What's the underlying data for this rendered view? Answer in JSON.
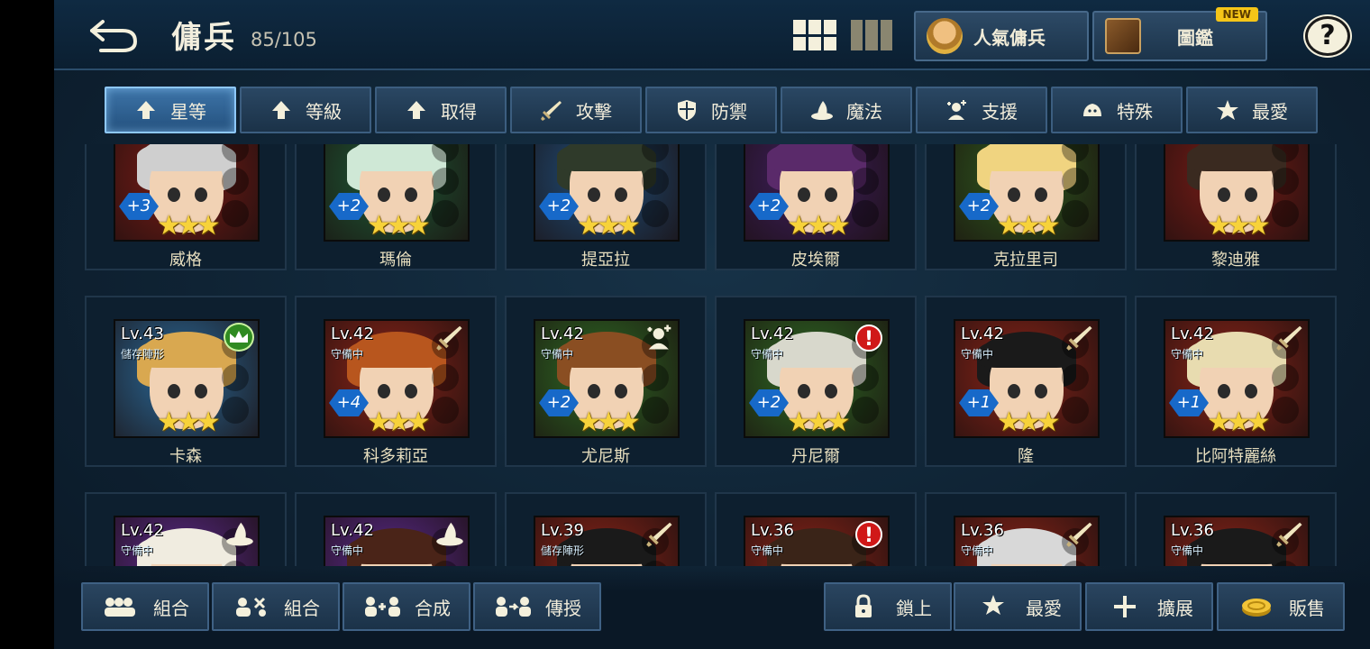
{
  "header": {
    "title": "傭兵",
    "count": "85/105",
    "popular_label": "人氣傭兵",
    "codex_label": "圖鑑",
    "new_badge": "NEW",
    "help": "?"
  },
  "sort_tabs": [
    {
      "label": "星等",
      "icon": "arrow-up-icon",
      "active": true
    },
    {
      "label": "等級",
      "icon": "arrow-up-icon"
    },
    {
      "label": "取得",
      "icon": "arrow-up-icon"
    },
    {
      "label": "攻擊",
      "icon": "sword-icon"
    },
    {
      "label": "防禦",
      "icon": "shield-icon"
    },
    {
      "label": "魔法",
      "icon": "wizard-hat-icon"
    },
    {
      "label": "支援",
      "icon": "support-icon"
    },
    {
      "label": "特殊",
      "icon": "slime-icon"
    },
    {
      "label": "最愛",
      "icon": "star-icon"
    }
  ],
  "mercenaries": [
    {
      "name": "威格",
      "plus": "+3",
      "stars": "★★★",
      "colors": {
        "bg": "#7a1c16",
        "hair": "#cfcfcf"
      }
    },
    {
      "name": "瑪倫",
      "plus": "+2",
      "stars": "★★★",
      "colors": {
        "bg": "#1e5a36",
        "hair": "#cfe8d6"
      }
    },
    {
      "name": "提亞拉",
      "plus": "+2",
      "stars": "★★★",
      "colors": {
        "bg": "#1f4e7a",
        "hair": "#2f3a2a"
      }
    },
    {
      "name": "皮埃爾",
      "plus": "+2",
      "stars": "★★★",
      "colors": {
        "bg": "#3e1f5e",
        "hair": "#5a2a6a"
      }
    },
    {
      "name": "克拉里司",
      "plus": "+2",
      "stars": "★★★",
      "colors": {
        "bg": "#2e5a1e",
        "hair": "#f0d480"
      }
    },
    {
      "name": "黎迪雅",
      "plus": "",
      "stars": "★★★",
      "colors": {
        "bg": "#7a1c16",
        "hair": "#3a2a20"
      }
    },
    {
      "name": "卡森",
      "level": "Lv.43",
      "status": "儲存陣形",
      "plus": "",
      "stars": "★★★",
      "badge": "crown-icon",
      "colors": {
        "bg": "#2a6a9a",
        "hair": "#d9a850"
      }
    },
    {
      "name": "科多莉亞",
      "level": "Lv.42",
      "status": "守備中",
      "plus": "+4",
      "stars": "★★★",
      "badge": "sword-icon",
      "colors": {
        "bg": "#8a2418",
        "hair": "#b8561e"
      }
    },
    {
      "name": "尤尼斯",
      "level": "Lv.42",
      "status": "守備中",
      "plus": "+2",
      "stars": "★★★",
      "badge": "support-icon",
      "colors": {
        "bg": "#2e6a24",
        "hair": "#8a4e22"
      }
    },
    {
      "name": "丹尼爾",
      "level": "Lv.42",
      "status": "守備中",
      "plus": "+2",
      "stars": "★★★",
      "badge": "alert-icon",
      "colors": {
        "bg": "#2e6a24",
        "hair": "#d8d8cc"
      }
    },
    {
      "name": "隆",
      "level": "Lv.42",
      "status": "守備中",
      "plus": "+1",
      "stars": "★★★",
      "badge": "sword-icon",
      "colors": {
        "bg": "#8a2418",
        "hair": "#1a1a1a"
      }
    },
    {
      "name": "比阿特麗絲",
      "level": "Lv.42",
      "status": "守備中",
      "plus": "+1",
      "stars": "★★★",
      "badge": "sword-icon",
      "colors": {
        "bg": "#8a2418",
        "hair": "#e8dcb0"
      }
    },
    {
      "name": "",
      "level": "Lv.42",
      "status": "守備中",
      "plus": "",
      "stars": "",
      "badge": "wizard-hat-icon",
      "colors": {
        "bg": "#5a2a8a",
        "hair": "#f0ece0"
      }
    },
    {
      "name": "",
      "level": "Lv.42",
      "status": "守備中",
      "plus": "",
      "stars": "",
      "badge": "wizard-hat-icon",
      "colors": {
        "bg": "#5a2a8a",
        "hair": "#4a2418"
      }
    },
    {
      "name": "",
      "level": "Lv.39",
      "status": "儲存陣形",
      "plus": "",
      "stars": "",
      "badge": "sword-icon",
      "colors": {
        "bg": "#8a2418",
        "hair": "#1a1a1a"
      }
    },
    {
      "name": "",
      "level": "Lv.36",
      "status": "守備中",
      "plus": "",
      "stars": "",
      "badge": "alert-icon",
      "colors": {
        "bg": "#8a2418",
        "hair": "#3a2418"
      }
    },
    {
      "name": "",
      "level": "Lv.36",
      "status": "守備中",
      "plus": "",
      "stars": "",
      "badge": "sword-icon",
      "colors": {
        "bg": "#8a2418",
        "hair": "#d8d8d8"
      }
    },
    {
      "name": "",
      "level": "Lv.36",
      "status": "守備中",
      "plus": "",
      "stars": "",
      "badge": "sword-icon",
      "colors": {
        "bg": "#8a2418",
        "hair": "#1a1a1a"
      }
    }
  ],
  "bottom_buttons": [
    {
      "label": "組合",
      "icon": "team-icon"
    },
    {
      "label": "組合",
      "icon": "team-swap-icon"
    },
    {
      "label": "合成",
      "icon": "fuse-icon"
    },
    {
      "label": "傳授",
      "icon": "transfer-icon"
    },
    {
      "label": "鎖上",
      "icon": "lock-icon"
    },
    {
      "label": "最愛",
      "icon": "star-icon"
    },
    {
      "label": "擴展",
      "icon": "plus-icon"
    },
    {
      "label": "販售",
      "icon": "gold-coin-icon"
    }
  ],
  "alert_mark": "!",
  "colors": {
    "accent": "#8ec8ff",
    "star": "#f7d23a",
    "plus_badge": "#1769c9",
    "alert": "#d01818"
  }
}
